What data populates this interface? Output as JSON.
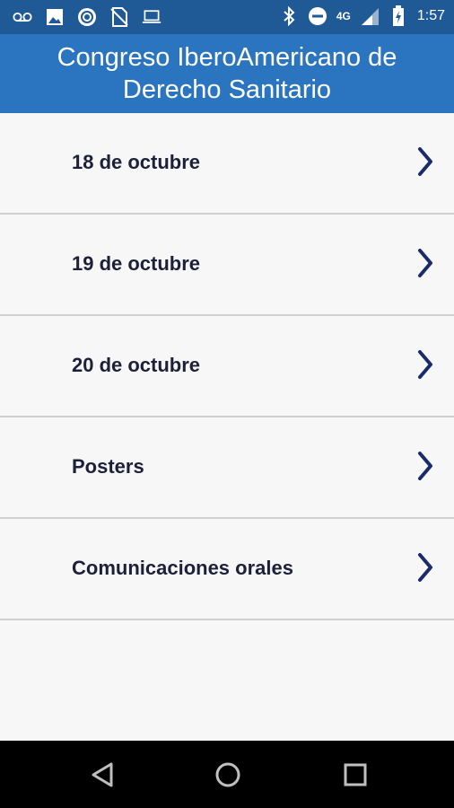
{
  "status_bar": {
    "time": "1:57",
    "network": "4G",
    "left_icons": [
      "voicemail-icon",
      "image-icon",
      "circle-app-icon",
      "no-sim-icon",
      "laptop-icon"
    ],
    "right_icons": [
      "bluetooth-icon",
      "do-not-disturb-icon",
      "signal-icon",
      "battery-icon"
    ]
  },
  "header": {
    "title": "Congreso IberoAmericano de Derecho Sanitario"
  },
  "menu": {
    "items": [
      {
        "label": "18 de octubre"
      },
      {
        "label": "19 de octubre"
      },
      {
        "label": "20 de octubre"
      },
      {
        "label": "Posters"
      },
      {
        "label": "Comunicaciones orales"
      }
    ]
  },
  "navigation": {
    "buttons": [
      "back-icon",
      "home-icon",
      "recents-icon"
    ]
  },
  "colors": {
    "status_bar": "#1f5a97",
    "app_bar": "#2a74c0",
    "list_text": "#1c2038",
    "chevron": "#1b2a6b",
    "divider": "#cfcfcf",
    "background": "#f7f7f7"
  }
}
